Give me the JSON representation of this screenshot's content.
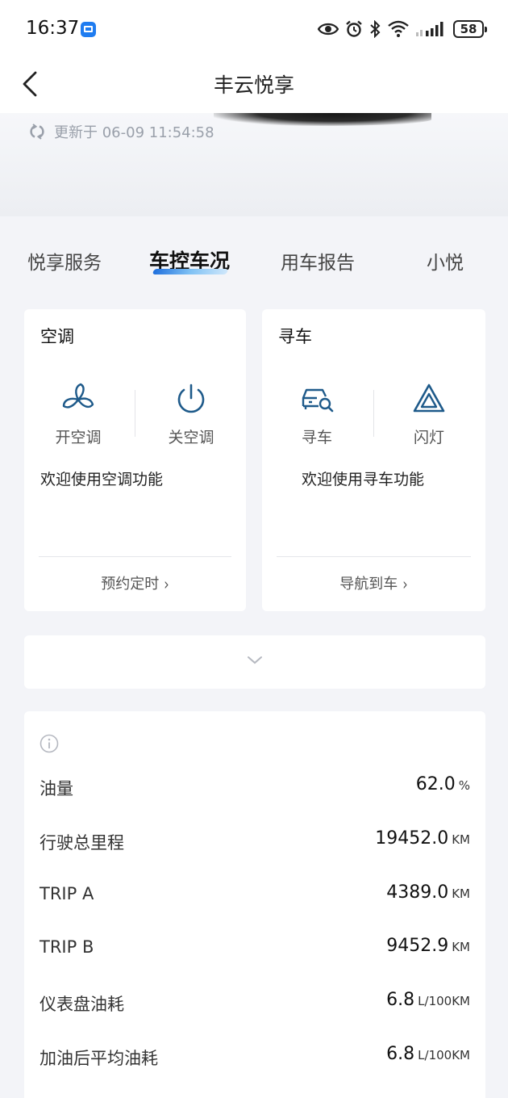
{
  "status_bar": {
    "time": "16:37",
    "battery": "58"
  },
  "nav": {
    "title": "丰云悦享"
  },
  "update": {
    "text": "更新于 06-09 11:54:58"
  },
  "tabs": [
    {
      "label": "悦享服务"
    },
    {
      "label": "车控车况"
    },
    {
      "label": "用车报告"
    },
    {
      "label": "小悦"
    }
  ],
  "ac_card": {
    "title": "空调",
    "on_label": "开空调",
    "off_label": "关空调",
    "welcome": "欢迎使用空调功能",
    "link": "预约定时"
  },
  "find_card": {
    "title": "寻车",
    "find_label": "寻车",
    "flash_label": "闪灯",
    "welcome": "欢迎使用寻车功能",
    "link": "导航到车"
  },
  "stats": [
    {
      "label": "油量",
      "value": "62.0",
      "unit": "%"
    },
    {
      "label": "行驶总里程",
      "value": "19452.0",
      "unit": "KM"
    },
    {
      "label": "TRIP A",
      "value": "4389.0",
      "unit": "KM"
    },
    {
      "label": "TRIP B",
      "value": "9452.9",
      "unit": "KM"
    },
    {
      "label": "仪表盘油耗",
      "value": "6.8",
      "unit": "L/100KM"
    },
    {
      "label": "加油后平均油耗",
      "value": "6.8",
      "unit": "L/100KM"
    }
  ],
  "colors": {
    "accent": "#1f6fdd",
    "icon_blue": "#1e5a8a"
  }
}
